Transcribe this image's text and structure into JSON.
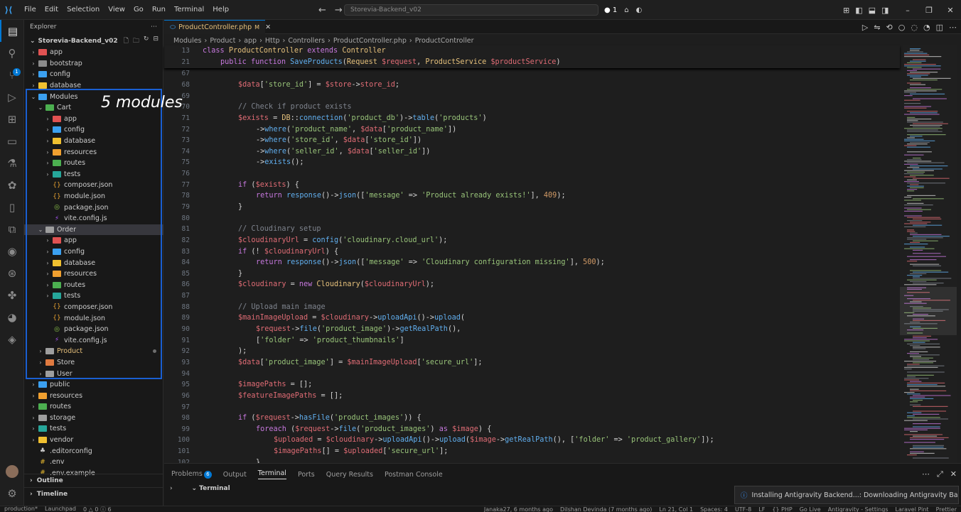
{
  "titlebar": {
    "menu": [
      "File",
      "Edit",
      "Selection",
      "View",
      "Go",
      "Run",
      "Terminal",
      "Help"
    ],
    "search_text": "Storevia-Backend_v02",
    "indicator": "● 1"
  },
  "sidebar": {
    "title": "Explorer",
    "project": "Storevia-Backend_v02",
    "annotation": "5 modules",
    "outline": "Outline",
    "timeline": "Timeline",
    "tree": [
      {
        "label": "app",
        "depth": 0,
        "open": false,
        "icon": "folder-app",
        "color": "#e05252"
      },
      {
        "label": "bootstrap",
        "depth": 0,
        "open": false,
        "icon": "folder",
        "color": "#8b8b8b"
      },
      {
        "label": "config",
        "depth": 0,
        "open": false,
        "icon": "folder-config",
        "color": "#3ba0f0"
      },
      {
        "label": "database",
        "depth": 0,
        "open": false,
        "icon": "folder-database",
        "color": "#f0c030"
      },
      {
        "label": "Modules",
        "depth": 0,
        "open": true,
        "icon": "folder-modules",
        "color": "#3ba0f0",
        "selected": true
      },
      {
        "label": "Cart",
        "depth": 1,
        "open": true,
        "icon": "folder-cart",
        "color": "#4caf50"
      },
      {
        "label": "app",
        "depth": 2,
        "open": false,
        "icon": "folder-app",
        "color": "#e05252"
      },
      {
        "label": "config",
        "depth": 2,
        "open": false,
        "icon": "folder-config",
        "color": "#3ba0f0"
      },
      {
        "label": "database",
        "depth": 2,
        "open": false,
        "icon": "folder-database",
        "color": "#f0c030"
      },
      {
        "label": "resources",
        "depth": 2,
        "open": false,
        "icon": "folder-resources",
        "color": "#f0a030"
      },
      {
        "label": "routes",
        "depth": 2,
        "open": false,
        "icon": "folder-routes",
        "color": "#4caf50"
      },
      {
        "label": "tests",
        "depth": 2,
        "open": false,
        "icon": "folder-tests",
        "color": "#26a69a"
      },
      {
        "label": "composer.json",
        "depth": 2,
        "file": true,
        "glyph": "{}",
        "color": "#e6a030"
      },
      {
        "label": "module.json",
        "depth": 2,
        "file": true,
        "glyph": "{}",
        "color": "#e6a030"
      },
      {
        "label": "package.json",
        "depth": 2,
        "file": true,
        "glyph": "◎",
        "color": "#8bc34a"
      },
      {
        "label": "vite.config.js",
        "depth": 2,
        "file": true,
        "glyph": "⚡",
        "color": "#a855f7"
      },
      {
        "label": "Order",
        "depth": 1,
        "open": true,
        "icon": "folder-order",
        "color": "#9e9e9e",
        "highlight": true
      },
      {
        "label": "app",
        "depth": 2,
        "open": false,
        "icon": "folder-app",
        "color": "#e05252"
      },
      {
        "label": "config",
        "depth": 2,
        "open": false,
        "icon": "folder-config",
        "color": "#3ba0f0"
      },
      {
        "label": "database",
        "depth": 2,
        "open": false,
        "icon": "folder-database",
        "color": "#f0c030"
      },
      {
        "label": "resources",
        "depth": 2,
        "open": false,
        "icon": "folder-resources",
        "color": "#f0a030"
      },
      {
        "label": "routes",
        "depth": 2,
        "open": false,
        "icon": "folder-routes",
        "color": "#4caf50"
      },
      {
        "label": "tests",
        "depth": 2,
        "open": false,
        "icon": "folder-tests",
        "color": "#26a69a"
      },
      {
        "label": "composer.json",
        "depth": 2,
        "file": true,
        "glyph": "{}",
        "color": "#e6a030"
      },
      {
        "label": "module.json",
        "depth": 2,
        "file": true,
        "glyph": "{}",
        "color": "#e6a030"
      },
      {
        "label": "package.json",
        "depth": 2,
        "file": true,
        "glyph": "◎",
        "color": "#8bc34a"
      },
      {
        "label": "vite.config.js",
        "depth": 2,
        "file": true,
        "glyph": "⚡",
        "color": "#a855f7"
      },
      {
        "label": "Product",
        "depth": 1,
        "open": false,
        "icon": "folder",
        "color": "#9e9e9e",
        "modified": true,
        "labelColor": "#e6c07b"
      },
      {
        "label": "Store",
        "depth": 1,
        "open": false,
        "icon": "folder-store",
        "color": "#e07a40"
      },
      {
        "label": "User",
        "depth": 1,
        "open": false,
        "icon": "folder",
        "color": "#9e9e9e"
      },
      {
        "label": "public",
        "depth": 0,
        "open": false,
        "icon": "folder-public",
        "color": "#3ba0f0"
      },
      {
        "label": "resources",
        "depth": 0,
        "open": false,
        "icon": "folder-resources",
        "color": "#f0a030"
      },
      {
        "label": "routes",
        "depth": 0,
        "open": false,
        "icon": "folder-routes",
        "color": "#4caf50"
      },
      {
        "label": "storage",
        "depth": 0,
        "open": false,
        "icon": "folder",
        "color": "#9e9e9e"
      },
      {
        "label": "tests",
        "depth": 0,
        "open": false,
        "icon": "folder-tests",
        "color": "#26a69a"
      },
      {
        "label": "vendor",
        "depth": 0,
        "open": false,
        "icon": "folder-vendor",
        "color": "#f0c030"
      },
      {
        "label": ".editorconfig",
        "depth": 0,
        "file": true,
        "glyph": "♣",
        "color": "#cccccc"
      },
      {
        "label": ".env",
        "depth": 0,
        "file": true,
        "glyph": "#",
        "color": "#f0c030"
      },
      {
        "label": ".env.example",
        "depth": 0,
        "file": true,
        "glyph": "#",
        "color": "#f0c030"
      }
    ]
  },
  "editor": {
    "tab_label": "ProductController.php",
    "tab_modified": "M",
    "breadcrumb": [
      "Modules",
      "Product",
      "app",
      "Http",
      "Controllers",
      "ProductController.php",
      "ProductController"
    ],
    "sticky": [
      {
        "ln": "13",
        "html": "<span class='k'>class</span> <span class='cl'>ProductController</span> <span class='k'>extends</span> <span class='cl'>Controller</span>",
        "indent": 0
      },
      {
        "ln": "21",
        "html": "<span class='k'>public</span> <span class='k'>function</span> <span class='f'>SaveProducts</span>(<span class='cl'>Request</span> <span class='v'>$request</span>, <span class='cl'>ProductService</span> <span class='v'>$productService</span>)",
        "indent": 1
      }
    ],
    "lines": [
      {
        "ln": "67",
        "html": "",
        "indent": 2
      },
      {
        "ln": "68",
        "html": "<span class='v'>$data</span>[<span class='s'>'store_id'</span>] = <span class='v'>$store</span>-&gt;<span class='v'>store_id</span>;",
        "indent": 2
      },
      {
        "ln": "69",
        "html": "",
        "indent": 2
      },
      {
        "ln": "70",
        "html": "<span class='c'>// Check if product exists</span>",
        "indent": 2
      },
      {
        "ln": "71",
        "html": "<span class='v'>$exists</span> = <span class='cl'>DB</span>::<span class='f'>connection</span>(<span class='s'>'product_db'</span>)-&gt;<span class='f'>table</span>(<span class='s'>'products'</span>)",
        "indent": 2
      },
      {
        "ln": "72",
        "html": "-&gt;<span class='f'>where</span>(<span class='s'>'product_name'</span>, <span class='v'>$data</span>[<span class='s'>'product_name'</span>])",
        "indent": 3
      },
      {
        "ln": "73",
        "html": "-&gt;<span class='f'>where</span>(<span class='s'>'store_id'</span>, <span class='v'>$data</span>[<span class='s'>'store_id'</span>])",
        "indent": 3
      },
      {
        "ln": "74",
        "html": "-&gt;<span class='f'>where</span>(<span class='s'>'seller_id'</span>, <span class='v'>$data</span>[<span class='s'>'seller_id'</span>])",
        "indent": 3
      },
      {
        "ln": "75",
        "html": "-&gt;<span class='f'>exists</span>();",
        "indent": 3
      },
      {
        "ln": "76",
        "html": "",
        "indent": 2
      },
      {
        "ln": "77",
        "html": "<span class='k'>if</span> (<span class='v'>$exists</span>) {",
        "indent": 2
      },
      {
        "ln": "78",
        "html": "<span class='k'>return</span> <span class='f'>response</span>()-&gt;<span class='f'>json</span>([<span class='s'>'message'</span> =&gt; <span class='s'>'Product already exists!'</span>], <span class='n'>409</span>);",
        "indent": 3
      },
      {
        "ln": "79",
        "html": "}",
        "indent": 2
      },
      {
        "ln": "80",
        "html": "",
        "indent": 2
      },
      {
        "ln": "81",
        "html": "<span class='c'>// Cloudinary setup</span>",
        "indent": 2
      },
      {
        "ln": "82",
        "html": "<span class='v'>$cloudinaryUrl</span> = <span class='f'>config</span>(<span class='s'>'cloudinary.cloud_url'</span>);",
        "indent": 2
      },
      {
        "ln": "83",
        "html": "<span class='k'>if</span> (! <span class='v'>$cloudinaryUrl</span>) {",
        "indent": 2
      },
      {
        "ln": "84",
        "html": "<span class='k'>return</span> <span class='f'>response</span>()-&gt;<span class='f'>json</span>([<span class='s'>'message'</span> =&gt; <span class='s'>'Cloudinary configuration missing'</span>], <span class='n'>500</span>);",
        "indent": 3
      },
      {
        "ln": "85",
        "html": "}",
        "indent": 2
      },
      {
        "ln": "86",
        "html": "<span class='v'>$cloudinary</span> = <span class='k'>new</span> <span class='cl'>Cloudinary</span>(<span class='v'>$cloudinaryUrl</span>);",
        "indent": 2
      },
      {
        "ln": "87",
        "html": "",
        "indent": 2
      },
      {
        "ln": "88",
        "html": "<span class='c'>// Upload main image</span>",
        "indent": 2
      },
      {
        "ln": "89",
        "html": "<span class='v'>$mainImageUpload</span> = <span class='v'>$cloudinary</span>-&gt;<span class='f'>uploadApi</span>()-&gt;<span class='f'>upload</span>(",
        "indent": 2
      },
      {
        "ln": "90",
        "html": "<span class='v'>$request</span>-&gt;<span class='f'>file</span>(<span class='s'>'product_image'</span>)-&gt;<span class='f'>getRealPath</span>(),",
        "indent": 3
      },
      {
        "ln": "91",
        "html": "[<span class='s'>'folder'</span> =&gt; <span class='s'>'product_thumbnails'</span>]",
        "indent": 3
      },
      {
        "ln": "92",
        "html": ");",
        "indent": 2
      },
      {
        "ln": "93",
        "html": "<span class='v'>$data</span>[<span class='s'>'product_image'</span>] = <span class='v'>$mainImageUpload</span>[<span class='s'>'secure_url'</span>];",
        "indent": 2
      },
      {
        "ln": "94",
        "html": "",
        "indent": 2
      },
      {
        "ln": "95",
        "html": "<span class='v'>$imagePaths</span> = [];",
        "indent": 2
      },
      {
        "ln": "96",
        "html": "<span class='v'>$featureImagePaths</span> = [];",
        "indent": 2
      },
      {
        "ln": "97",
        "html": "",
        "indent": 2
      },
      {
        "ln": "98",
        "html": "<span class='k'>if</span> (<span class='v'>$request</span>-&gt;<span class='f'>hasFile</span>(<span class='s'>'product_images'</span>)) {",
        "indent": 2
      },
      {
        "ln": "99",
        "html": "<span class='k'>foreach</span> (<span class='v'>$request</span>-&gt;<span class='f'>file</span>(<span class='s'>'product_images'</span>) <span class='k'>as</span> <span class='v'>$image</span>) {",
        "indent": 3
      },
      {
        "ln": "100",
        "html": "<span class='v'>$uploaded</span> = <span class='v'>$cloudinary</span>-&gt;<span class='f'>uploadApi</span>()-&gt;<span class='f'>upload</span>(<span class='v'>$image</span>-&gt;<span class='f'>getRealPath</span>(), [<span class='s'>'folder'</span> =&gt; <span class='s'>'product_gallery'</span>]);",
        "indent": 4
      },
      {
        "ln": "101",
        "html": "<span class='v'>$imagePaths</span>[] = <span class='v'>$uploaded</span>[<span class='s'>'secure_url'</span>];",
        "indent": 4
      },
      {
        "ln": "102",
        "html": "}",
        "indent": 3
      }
    ]
  },
  "panel": {
    "tabs": [
      "Problems",
      "Output",
      "Terminal",
      "Ports",
      "Query Results",
      "Postman Console"
    ],
    "problems_count": "6",
    "active_tab": "Terminal",
    "terminal_label": "Terminal",
    "notification": "Installing Antigravity Backend...: Downloading Antigravity Backend (30..."
  },
  "statusbar": {
    "left": [
      "production*",
      "Launchpad",
      "0 △ 0 ⓘ 6"
    ],
    "right": [
      "Janaka27, 6 months ago",
      "Dilshan Devinda (7 months ago)",
      "Ln 21, Col 1",
      "Spaces: 4",
      "UTF-8",
      "LF",
      "{} PHP",
      "Go Live",
      "Antigravity - Settings",
      "Laravel Pint",
      "Prettier"
    ]
  }
}
